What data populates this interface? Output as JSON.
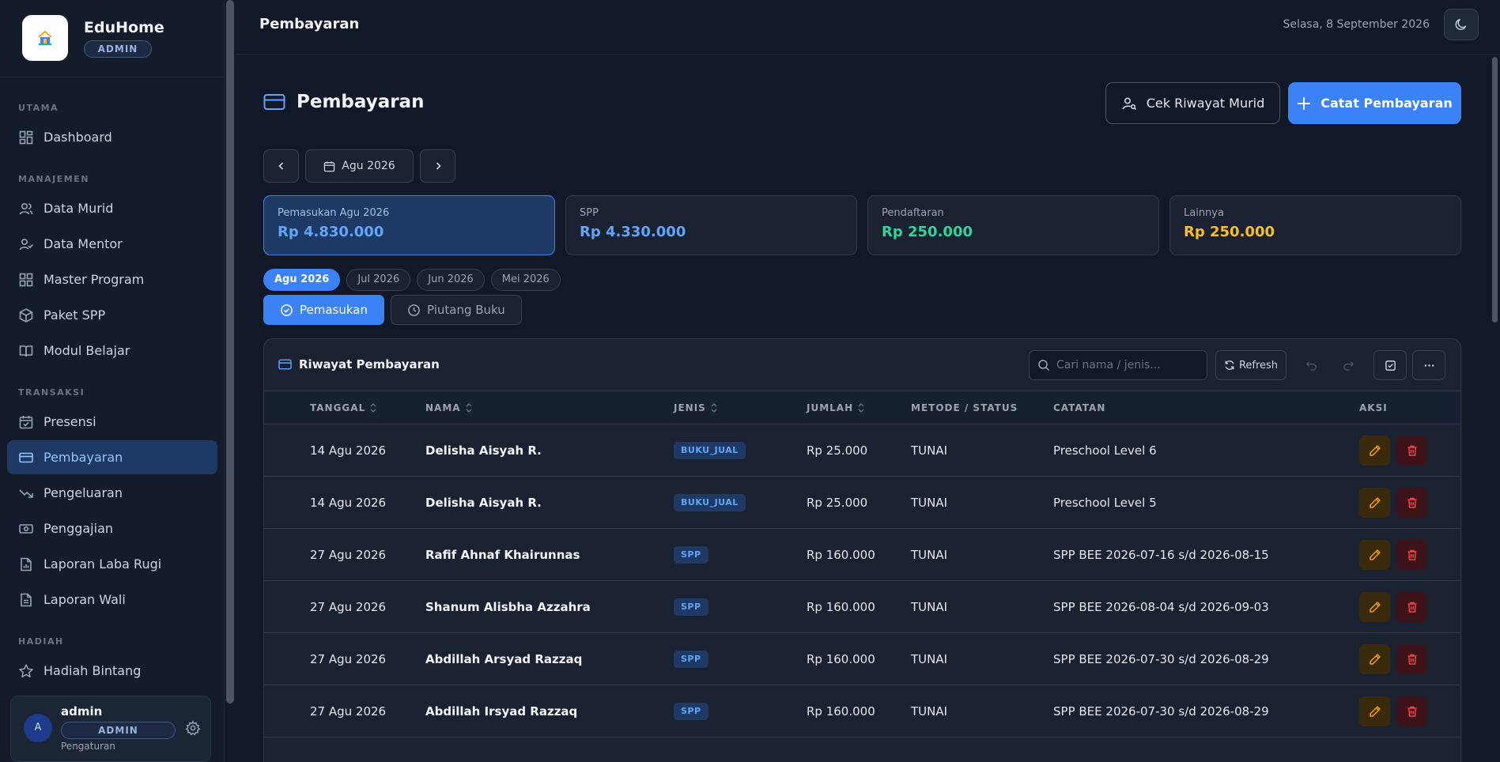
{
  "app": {
    "name": "EduHome",
    "role_badge": "ADMIN"
  },
  "sidebar": {
    "sections": [
      {
        "title": "UTAMA",
        "items": [
          {
            "label": "Dashboard",
            "icon": "dashboard-icon"
          }
        ]
      },
      {
        "title": "MANAJEMEN",
        "items": [
          {
            "label": "Data Murid",
            "icon": "users-icon"
          },
          {
            "label": "Data Mentor",
            "icon": "user-check-icon"
          },
          {
            "label": "Master Program",
            "icon": "grid-icon"
          },
          {
            "label": "Paket SPP",
            "icon": "package-icon"
          },
          {
            "label": "Modul Belajar",
            "icon": "book-icon"
          }
        ]
      },
      {
        "title": "TRANSAKSI",
        "items": [
          {
            "label": "Presensi",
            "icon": "calendar-check-icon"
          },
          {
            "label": "Pembayaran",
            "icon": "credit-card-icon",
            "active": true
          },
          {
            "label": "Pengeluaran",
            "icon": "trending-down-icon"
          },
          {
            "label": "Penggajian",
            "icon": "banknote-icon"
          },
          {
            "label": "Laporan Laba Rugi",
            "icon": "file-chart-icon"
          },
          {
            "label": "Laporan Wali",
            "icon": "file-text-icon"
          }
        ]
      },
      {
        "title": "HADIAH",
        "items": [
          {
            "label": "Hadiah Bintang",
            "icon": "star-icon"
          }
        ]
      }
    ]
  },
  "user": {
    "avatar": "A",
    "name": "admin",
    "role": "ADMIN",
    "subtitle": "Pengaturan"
  },
  "topbar": {
    "title": "Pembayaran",
    "date": "Selasa, 8 September 2026"
  },
  "page": {
    "title": "Pembayaran",
    "btn_history": "Cek Riwayat Murid",
    "btn_record": "Catat Pembayaran",
    "month": "Agu 2026"
  },
  "stats": [
    {
      "label": "Pemasukan Agu 2026",
      "value": "Rp 4.830.000",
      "color": "#60a5fa"
    },
    {
      "label": "SPP",
      "value": "Rp 4.330.000",
      "color": "#60a5fa"
    },
    {
      "label": "Pendaftaran",
      "value": "Rp 250.000",
      "color": "#34d399"
    },
    {
      "label": "Lainnya",
      "value": "Rp 250.000",
      "color": "#fbbf24"
    }
  ],
  "month_chips": [
    "Agu 2026",
    "Jul 2026",
    "Jun 2026",
    "Mei 2026"
  ],
  "tabs": [
    "Pemasukan",
    "Piutang Buku"
  ],
  "table": {
    "title": "Riwayat Pembayaran",
    "search_placeholder": "Cari nama / jenis...",
    "refresh_label": "Refresh",
    "headers": [
      "TANGGAL",
      "NAMA",
      "JENIS",
      "JUMLAH",
      "METODE / STATUS",
      "CATATAN",
      "AKSI"
    ],
    "rows": [
      {
        "date": "14 Agu 2026",
        "name": "Delisha Aisyah R.",
        "type": "BUKU_JUAL",
        "amount": "Rp 25.000",
        "method": "TUNAI",
        "note": "Preschool Level 6"
      },
      {
        "date": "14 Agu 2026",
        "name": "Delisha Aisyah R.",
        "type": "BUKU_JUAL",
        "amount": "Rp 25.000",
        "method": "TUNAI",
        "note": "Preschool Level 5"
      },
      {
        "date": "27 Agu 2026",
        "name": "Rafif Ahnaf Khairunnas",
        "type": "SPP",
        "amount": "Rp 160.000",
        "method": "TUNAI",
        "note": "SPP BEE 2026-07-16 s/d 2026-08-15"
      },
      {
        "date": "27 Agu 2026",
        "name": "Shanum Alisbha Azzahra",
        "type": "SPP",
        "amount": "Rp 160.000",
        "method": "TUNAI",
        "note": "SPP BEE 2026-08-04 s/d 2026-09-03"
      },
      {
        "date": "27 Agu 2026",
        "name": "Abdillah Arsyad Razzaq",
        "type": "SPP",
        "amount": "Rp 160.000",
        "method": "TUNAI",
        "note": "SPP BEE 2026-07-30 s/d 2026-08-29"
      },
      {
        "date": "27 Agu 2026",
        "name": "Abdillah Irsyad Razzaq",
        "type": "SPP",
        "amount": "Rp 160.000",
        "method": "TUNAI",
        "note": "SPP BEE 2026-07-30 s/d 2026-08-29"
      }
    ]
  }
}
